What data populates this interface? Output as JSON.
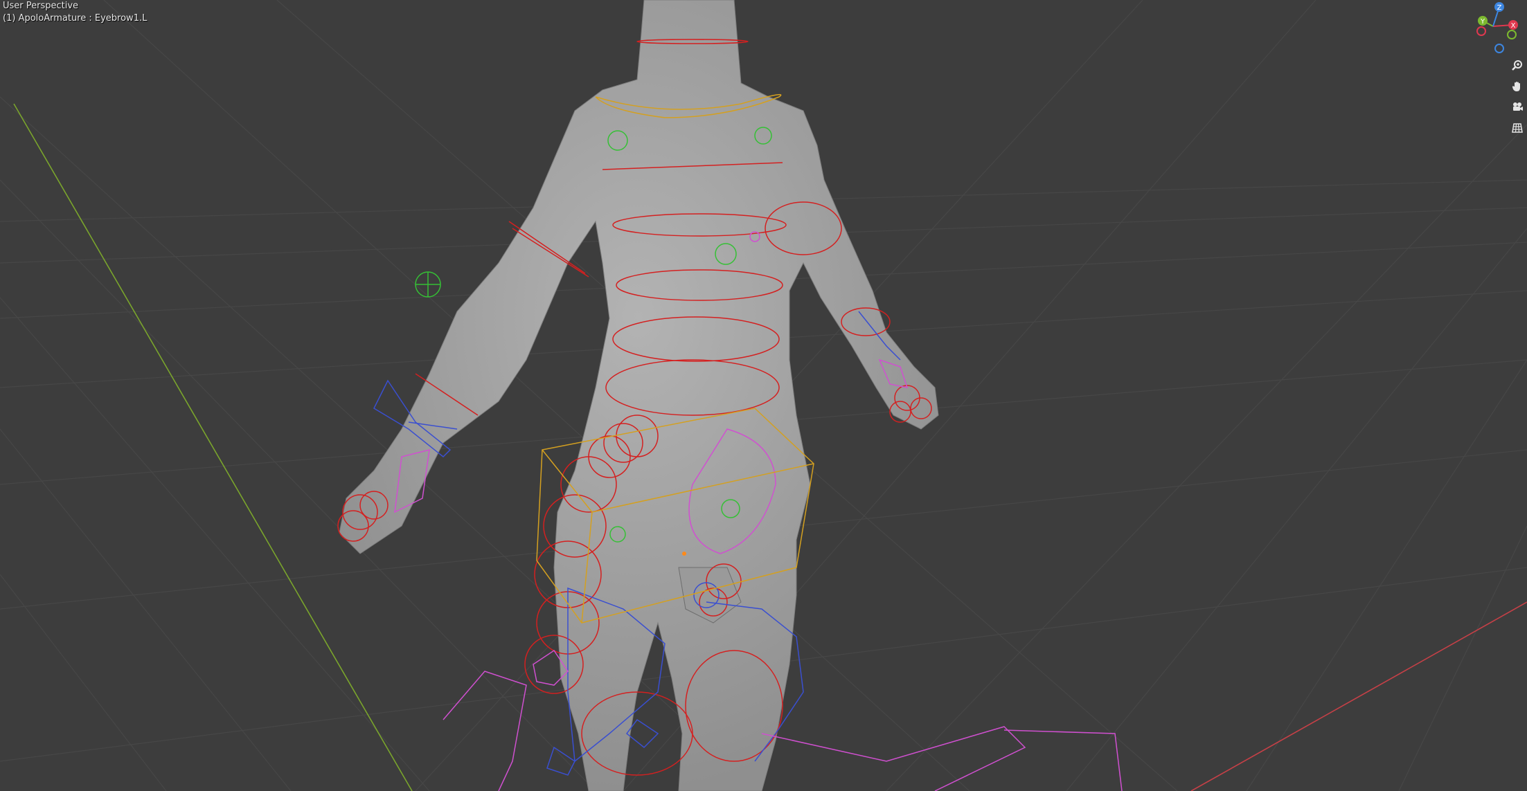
{
  "viewport": {
    "view_name": "User Perspective",
    "object_info": "(1) ApoloArmature : Eyebrow1.L"
  },
  "navigation_gizmo": {
    "axes": [
      {
        "name": "X",
        "color": "#e0384f"
      },
      {
        "name": "Y",
        "color": "#7dba2f"
      },
      {
        "name": "Z",
        "color": "#3d86e0"
      }
    ]
  },
  "nav_buttons": [
    {
      "icon": "zoom-icon"
    },
    {
      "icon": "pan-hand-icon"
    },
    {
      "icon": "camera-view-icon"
    },
    {
      "icon": "orthographic-grid-icon"
    }
  ],
  "colors": {
    "background": "#3d3d3d",
    "grid": "#474747",
    "mesh": "#a6a6a6",
    "x_axis": "#c64047",
    "y_axis": "#7aa52c",
    "bone_red": "#d42020",
    "bone_blue": "#3a4fd0",
    "bone_yellow": "#d4a020",
    "bone_green": "#35c035",
    "bone_magenta": "#d050d0"
  }
}
